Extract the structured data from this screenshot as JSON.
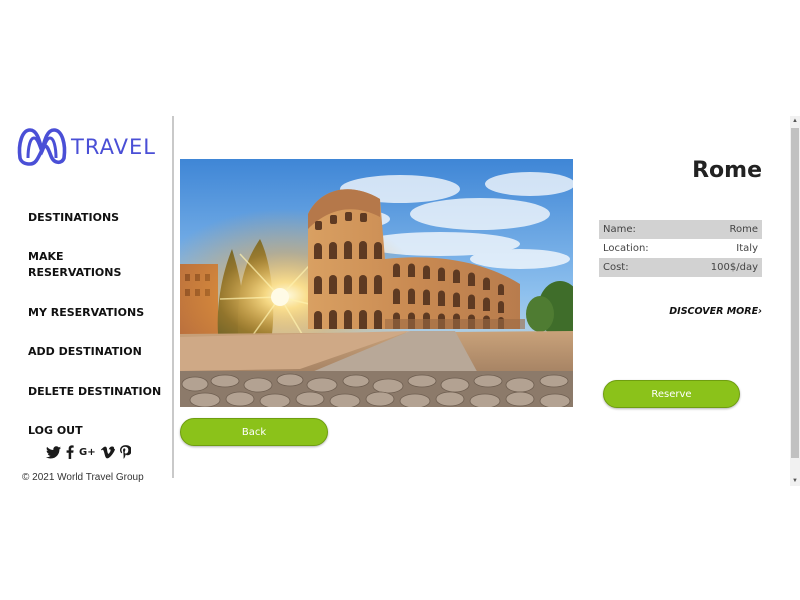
{
  "brand": {
    "name": "TRAVEL",
    "logo_icon": "infinity-m-logo",
    "accent": "#4a4fd6"
  },
  "sidebar": {
    "items": [
      {
        "label": "DESTINATIONS"
      },
      {
        "label_line1": "MAKE",
        "label_line2": "RESERVATIONS"
      },
      {
        "label": "MY RESERVATIONS"
      },
      {
        "label": "ADD DESTINATION"
      },
      {
        "label": "DELETE DESTINATION"
      },
      {
        "label": "LOG OUT"
      }
    ],
    "social": [
      "twitter-icon",
      "facebook-icon",
      "google-plus-icon",
      "vimeo-icon",
      "pinterest-icon"
    ],
    "google_plus_label": "G+",
    "copyright": "© 2021 World Travel Group"
  },
  "destination": {
    "title": "Rome",
    "image": "colosseum-photo",
    "details": [
      {
        "label": "Name:",
        "value": "Rome"
      },
      {
        "label": "Location:",
        "value": "Italy"
      },
      {
        "label": "Cost:",
        "value": "100$/day"
      }
    ],
    "discover_label": "DISCOVER MORE",
    "reserve_label": "Reserve",
    "back_label": "Back"
  },
  "colors": {
    "button": "#8bc21a",
    "table_shade": "#d2d2d2"
  }
}
